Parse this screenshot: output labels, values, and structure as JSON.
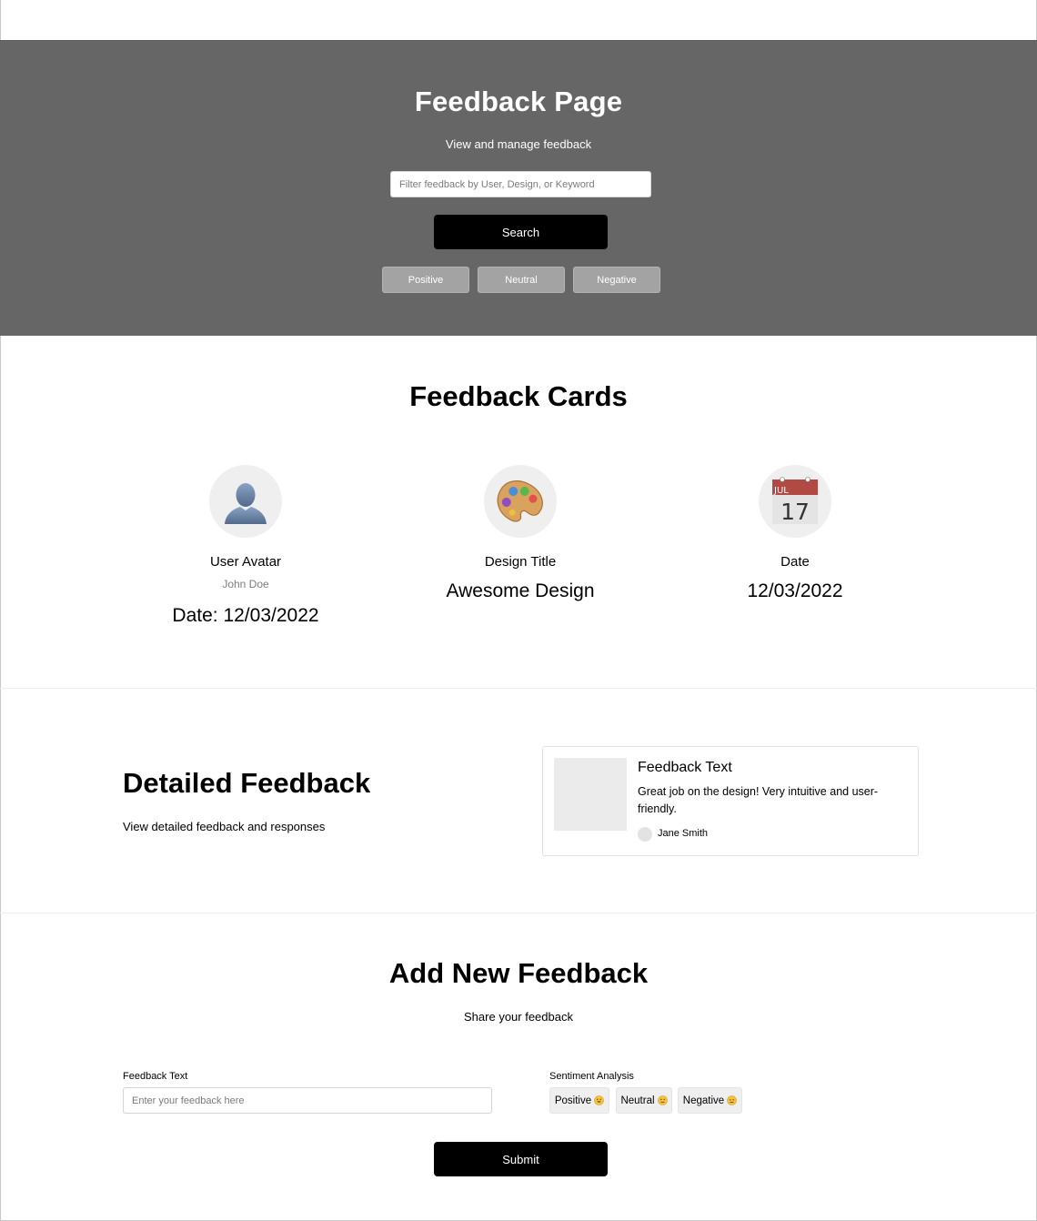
{
  "header": {
    "title": "Feedback Page",
    "subtitle": "View and manage feedback",
    "filter_placeholder": "Filter feedback by User, Design, or Keyword",
    "search_label": "Search",
    "filters": [
      "Positive",
      "Neutral",
      "Negative"
    ]
  },
  "cards": {
    "title": "Feedback Cards",
    "user": {
      "icon": "user-silhouette-icon",
      "label": "User Avatar",
      "name": "John Doe",
      "date": "Date: 12/03/2022"
    },
    "design": {
      "icon": "palette-icon",
      "label": "Design Title",
      "value": "Awesome Design"
    },
    "date": {
      "icon": "calendar-icon",
      "label": "Date",
      "value": "12/03/2022",
      "calendar_month": "JUL",
      "calendar_day": "17"
    }
  },
  "detailed": {
    "title": "Detailed Feedback",
    "subtitle": "View detailed feedback and responses",
    "card": {
      "title": "Feedback Text",
      "text": "Great job on the design! Very intuitive and user-friendly.",
      "author": "Jane Smith"
    }
  },
  "add_feedback": {
    "title": "Add New Feedback",
    "subtitle": "Share your feedback",
    "text_label": "Feedback Text",
    "text_placeholder": "Enter your feedback here",
    "sentiment_label": "Sentiment Analysis",
    "sentiments": [
      {
        "label": "Positive",
        "icon": "smiling-face-icon"
      },
      {
        "label": "Neutral",
        "icon": "neutral-face-icon"
      },
      {
        "label": "Negative",
        "icon": "sad-face-icon"
      }
    ],
    "submit_label": "Submit"
  },
  "colors": {
    "hero_bg": "#666666",
    "chip_bg": "#a3a3a3",
    "button_bg": "#000000",
    "circle_bg": "#efefef"
  }
}
